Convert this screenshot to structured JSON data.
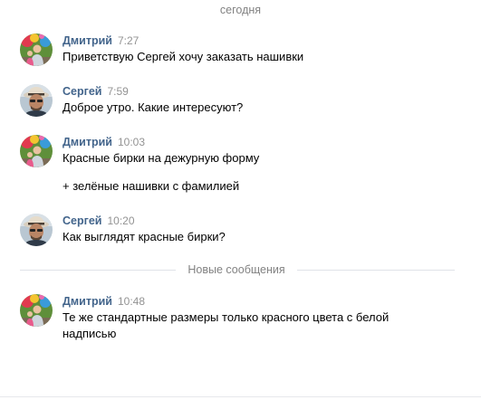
{
  "date_divider": "сегодня",
  "new_messages_divider": "Новые сообщения",
  "messages": [
    {
      "author": "Дмитрий",
      "time": "7:27",
      "text": "Приветствую Сергей хочу заказать нашивки",
      "avatar": "avatar-dmitry"
    },
    {
      "author": "Сергей",
      "time": "7:59",
      "text": "Доброе утро. Какие интересуют?",
      "avatar": "avatar-sergey"
    },
    {
      "author": "Дмитрий",
      "time": "10:03",
      "text": "Красные бирки на дежурную форму",
      "text2": "+ зелёные нашивки с фамилией",
      "avatar": "avatar-dmitry"
    },
    {
      "author": "Сергей",
      "time": "10:20",
      "text": "Как выглядят красные бирки?",
      "avatar": "avatar-sergey"
    },
    {
      "author": "Дмитрий",
      "time": "10:48",
      "text": "Те же стандартные размеры только красного цвета с белой надписью",
      "avatar": "avatar-dmitry"
    }
  ],
  "colors": {
    "author": "#42648b",
    "time": "#939393",
    "divider_text": "#828282",
    "divider_line": "#dfe2e8"
  }
}
